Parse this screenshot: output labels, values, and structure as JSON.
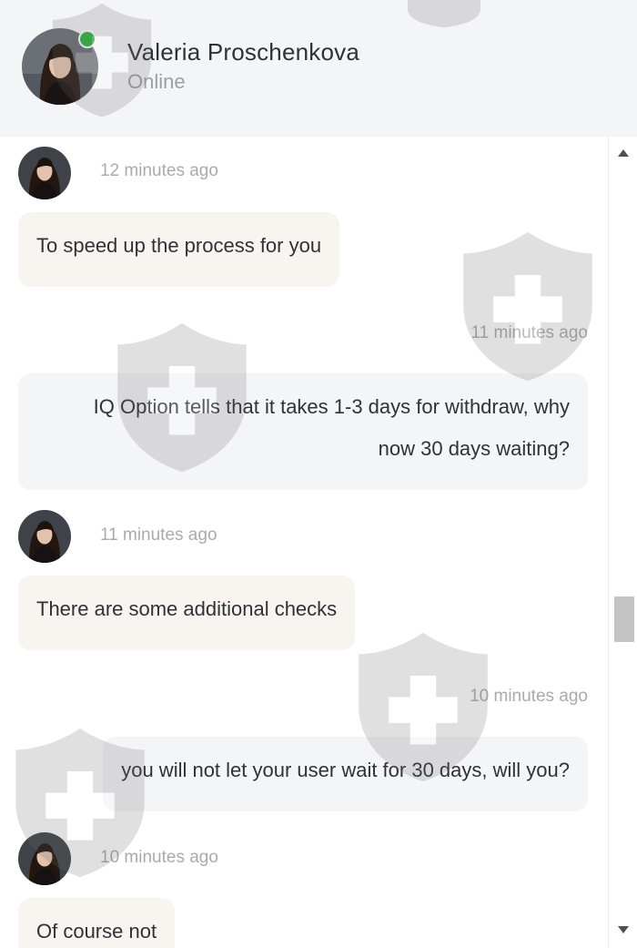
{
  "header": {
    "name": "Valeria Proschenkova",
    "status": "Online",
    "avatar_icon": "user-avatar-photo",
    "status_color": "#2fb344"
  },
  "messages": [
    {
      "sender": "agent",
      "time": "12 minutes ago",
      "lines": [
        "To speed up the process for you"
      ]
    },
    {
      "sender": "user",
      "time": "11 minutes ago",
      "lines": [
        "IQ Option tells that it takes 1-3 days for withdraw, why",
        "now 30 days waiting?"
      ]
    },
    {
      "sender": "agent",
      "time": "11 minutes ago",
      "lines": [
        "There are some additional checks"
      ]
    },
    {
      "sender": "user",
      "time": "10 minutes ago",
      "lines": [
        "you will not let your user wait for 30 days, will you?"
      ]
    },
    {
      "sender": "agent",
      "time": "10 minutes ago",
      "lines": [
        "Of course not"
      ]
    }
  ],
  "colors": {
    "agent_bubble": "#f8f5f0",
    "user_bubble": "#f4f5f7",
    "header_bg": "#f4f5f7",
    "text": "#2f3236",
    "timestamp": "#a7abb0"
  },
  "icons": [
    "scroll-up-arrow",
    "scroll-down-arrow",
    "shield-cross-watermark"
  ]
}
